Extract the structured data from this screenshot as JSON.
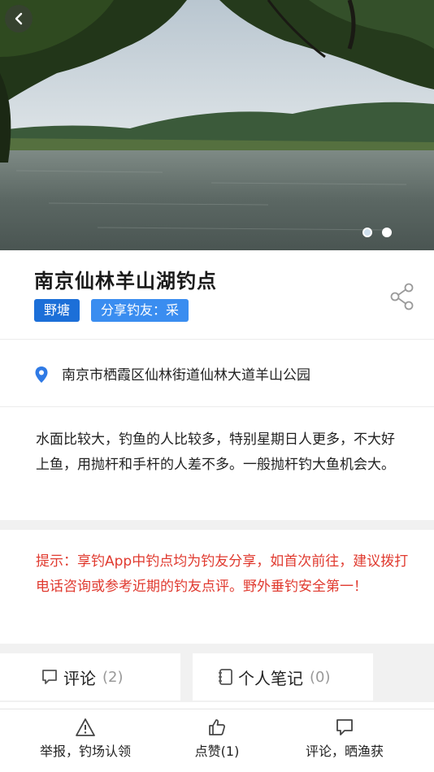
{
  "hero": {
    "image_alt": "lake view",
    "slide_count": 2,
    "active_slide": 1
  },
  "spot": {
    "title": "南京仙林羊山湖钓点",
    "tags": [
      "野塘",
      "分享钓友：采"
    ],
    "address": "南京市栖霞区仙林街道仙林大道羊山公园",
    "description": "水面比较大，钓鱼的人比较多，特别星期日人更多，不大好上鱼，用抛杆和手杆的人差不多。一般抛杆钓大鱼机会大。"
  },
  "notice": "提示：享钓App中钓点均为钓友分享，如首次前往，建议拨打电话咨询或参考近期的钓友点评。野外垂钓安全第一！",
  "tabs": [
    {
      "label": "评论",
      "count": "(2)"
    },
    {
      "label": "个人笔记",
      "count": "(0)"
    }
  ],
  "bottom_bar": {
    "report": "举报，钓场认领",
    "like": "点赞(1)",
    "comment": "评论，晒渔获"
  },
  "colors": {
    "tag_primary": "#1c6fd8",
    "tag_secondary": "#3a8df0",
    "notice_red": "#e03a2f",
    "pin_blue": "#2f7ae5"
  },
  "icons": [
    "back-arrow-icon",
    "share-icon",
    "location-pin-icon",
    "comment-icon",
    "notebook-icon",
    "warning-icon",
    "thumbs-up-icon",
    "message-icon"
  ]
}
